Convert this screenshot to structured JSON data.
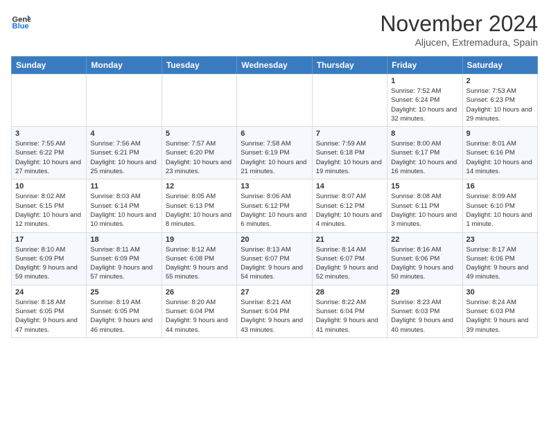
{
  "header": {
    "logo_general": "General",
    "logo_blue": "Blue",
    "month_title": "November 2024",
    "location": "Aljucen, Extremadura, Spain"
  },
  "weekdays": [
    "Sunday",
    "Monday",
    "Tuesday",
    "Wednesday",
    "Thursday",
    "Friday",
    "Saturday"
  ],
  "weeks": [
    [
      {
        "day": "",
        "info": ""
      },
      {
        "day": "",
        "info": ""
      },
      {
        "day": "",
        "info": ""
      },
      {
        "day": "",
        "info": ""
      },
      {
        "day": "",
        "info": ""
      },
      {
        "day": "1",
        "info": "Sunrise: 7:52 AM\nSunset: 6:24 PM\nDaylight: 10 hours and 32 minutes."
      },
      {
        "day": "2",
        "info": "Sunrise: 7:53 AM\nSunset: 6:23 PM\nDaylight: 10 hours and 29 minutes."
      }
    ],
    [
      {
        "day": "3",
        "info": "Sunrise: 7:55 AM\nSunset: 6:22 PM\nDaylight: 10 hours and 27 minutes."
      },
      {
        "day": "4",
        "info": "Sunrise: 7:56 AM\nSunset: 6:21 PM\nDaylight: 10 hours and 25 minutes."
      },
      {
        "day": "5",
        "info": "Sunrise: 7:57 AM\nSunset: 6:20 PM\nDaylight: 10 hours and 23 minutes."
      },
      {
        "day": "6",
        "info": "Sunrise: 7:58 AM\nSunset: 6:19 PM\nDaylight: 10 hours and 21 minutes."
      },
      {
        "day": "7",
        "info": "Sunrise: 7:59 AM\nSunset: 6:18 PM\nDaylight: 10 hours and 19 minutes."
      },
      {
        "day": "8",
        "info": "Sunrise: 8:00 AM\nSunset: 6:17 PM\nDaylight: 10 hours and 16 minutes."
      },
      {
        "day": "9",
        "info": "Sunrise: 8:01 AM\nSunset: 6:16 PM\nDaylight: 10 hours and 14 minutes."
      }
    ],
    [
      {
        "day": "10",
        "info": "Sunrise: 8:02 AM\nSunset: 6:15 PM\nDaylight: 10 hours and 12 minutes."
      },
      {
        "day": "11",
        "info": "Sunrise: 8:03 AM\nSunset: 6:14 PM\nDaylight: 10 hours and 10 minutes."
      },
      {
        "day": "12",
        "info": "Sunrise: 8:05 AM\nSunset: 6:13 PM\nDaylight: 10 hours and 8 minutes."
      },
      {
        "day": "13",
        "info": "Sunrise: 8:06 AM\nSunset: 6:12 PM\nDaylight: 10 hours and 6 minutes."
      },
      {
        "day": "14",
        "info": "Sunrise: 8:07 AM\nSunset: 6:12 PM\nDaylight: 10 hours and 4 minutes."
      },
      {
        "day": "15",
        "info": "Sunrise: 8:08 AM\nSunset: 6:11 PM\nDaylight: 10 hours and 3 minutes."
      },
      {
        "day": "16",
        "info": "Sunrise: 8:09 AM\nSunset: 6:10 PM\nDaylight: 10 hours and 1 minute."
      }
    ],
    [
      {
        "day": "17",
        "info": "Sunrise: 8:10 AM\nSunset: 6:09 PM\nDaylight: 9 hours and 59 minutes."
      },
      {
        "day": "18",
        "info": "Sunrise: 8:11 AM\nSunset: 6:09 PM\nDaylight: 9 hours and 57 minutes."
      },
      {
        "day": "19",
        "info": "Sunrise: 8:12 AM\nSunset: 6:08 PM\nDaylight: 9 hours and 55 minutes."
      },
      {
        "day": "20",
        "info": "Sunrise: 8:13 AM\nSunset: 6:07 PM\nDaylight: 9 hours and 54 minutes."
      },
      {
        "day": "21",
        "info": "Sunrise: 8:14 AM\nSunset: 6:07 PM\nDaylight: 9 hours and 52 minutes."
      },
      {
        "day": "22",
        "info": "Sunrise: 8:16 AM\nSunset: 6:06 PM\nDaylight: 9 hours and 50 minutes."
      },
      {
        "day": "23",
        "info": "Sunrise: 8:17 AM\nSunset: 6:06 PM\nDaylight: 9 hours and 49 minutes."
      }
    ],
    [
      {
        "day": "24",
        "info": "Sunrise: 8:18 AM\nSunset: 6:05 PM\nDaylight: 9 hours and 47 minutes."
      },
      {
        "day": "25",
        "info": "Sunrise: 8:19 AM\nSunset: 6:05 PM\nDaylight: 9 hours and 46 minutes."
      },
      {
        "day": "26",
        "info": "Sunrise: 8:20 AM\nSunset: 6:04 PM\nDaylight: 9 hours and 44 minutes."
      },
      {
        "day": "27",
        "info": "Sunrise: 8:21 AM\nSunset: 6:04 PM\nDaylight: 9 hours and 43 minutes."
      },
      {
        "day": "28",
        "info": "Sunrise: 8:22 AM\nSunset: 6:04 PM\nDaylight: 9 hours and 41 minutes."
      },
      {
        "day": "29",
        "info": "Sunrise: 8:23 AM\nSunset: 6:03 PM\nDaylight: 9 hours and 40 minutes."
      },
      {
        "day": "30",
        "info": "Sunrise: 8:24 AM\nSunset: 6:03 PM\nDaylight: 9 hours and 39 minutes."
      }
    ]
  ]
}
